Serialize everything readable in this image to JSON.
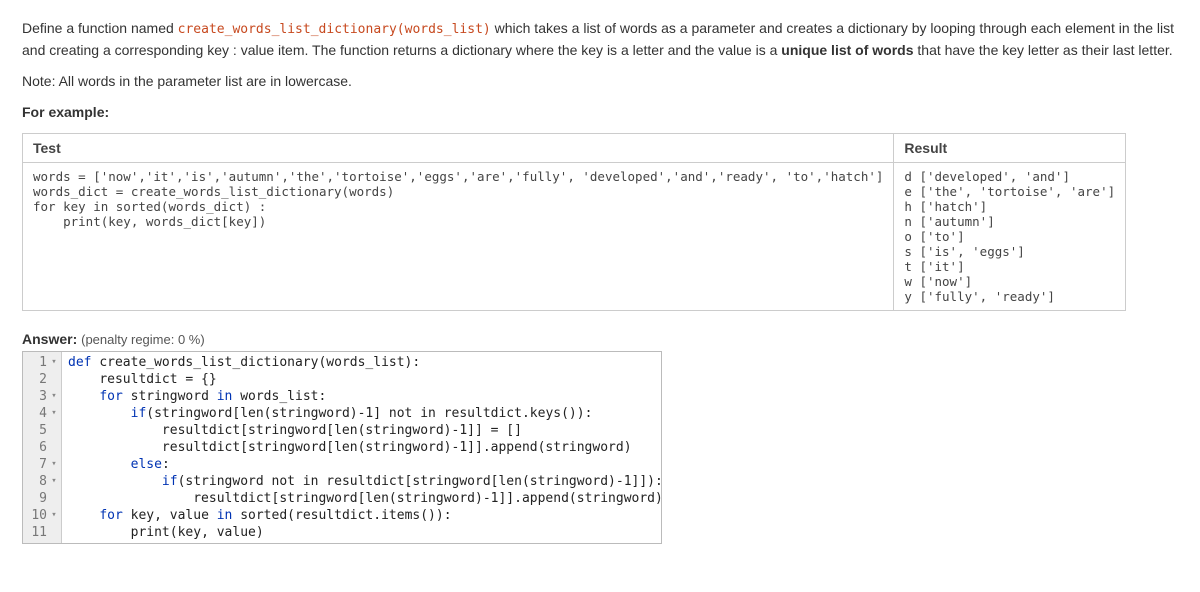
{
  "question": {
    "para1_pre": "Define a function named ",
    "para1_code": "create_words_list_dictionary(words_list)",
    "para1_post": " which takes a list of words as a parameter and creates a dictionary by looping through each element in the list and creating a corresponding key : value item. The function returns a dictionary where the key is a letter and the value is a ",
    "para1_bold": "unique list of words",
    "para1_tail": " that have the key letter as their last letter.",
    "para2": "Note: All words in the parameter list are in lowercase.",
    "para3": "For example:"
  },
  "table": {
    "h1": "Test",
    "h2": "Result",
    "test": "words = ['now','it','is','autumn','the','tortoise','eggs','are','fully', 'developed','and','ready', 'to','hatch']\nwords_dict = create_words_list_dictionary(words)\nfor key in sorted(words_dict) :\n    print(key, words_dict[key])",
    "result": "d ['developed', 'and']\ne ['the', 'tortoise', 'are']\nh ['hatch']\nn ['autumn']\no ['to']\ns ['is', 'eggs']\nt ['it']\nw ['now']\ny ['fully', 'ready']"
  },
  "answer": {
    "label": "Answer:",
    "penalty": "(penalty regime: 0 %)"
  },
  "code": {
    "lines": [
      {
        "n": "1",
        "fold": "▾",
        "kw": "def ",
        "rest": "create_words_list_dictionary(words_list):"
      },
      {
        "n": "2",
        "fold": "",
        "indent": "    ",
        "rest": "resultdict = {}"
      },
      {
        "n": "3",
        "fold": "▾",
        "indent": "    ",
        "kw": "for ",
        "mid": "stringword ",
        "kw2": "in ",
        "rest": "words_list:"
      },
      {
        "n": "4",
        "fold": "▾",
        "indent": "        ",
        "kw": "if",
        "rest": "(stringword[len(stringword)-1] not in resultdict.keys()):"
      },
      {
        "n": "5",
        "fold": "",
        "indent": "            ",
        "rest": "resultdict[stringword[len(stringword)-1]] = []"
      },
      {
        "n": "6",
        "fold": "",
        "indent": "            ",
        "rest": "resultdict[stringword[len(stringword)-1]].append(stringword)"
      },
      {
        "n": "7",
        "fold": "▾",
        "indent": "        ",
        "kw": "else",
        "rest": ":"
      },
      {
        "n": "8",
        "fold": "▾",
        "indent": "            ",
        "kw": "if",
        "rest": "(stringword not in resultdict[stringword[len(stringword)-1]]):"
      },
      {
        "n": "9",
        "fold": "",
        "indent": "                ",
        "rest": "resultdict[stringword[len(stringword)-1]].append(stringword)"
      },
      {
        "n": "10",
        "fold": "▾",
        "indent": "    ",
        "kw": "for ",
        "mid": "key, value ",
        "kw2": "in ",
        "rest": "sorted(resultdict.items()):"
      },
      {
        "n": "11",
        "fold": "",
        "indent": "        ",
        "rest": "print(key, value)"
      }
    ]
  }
}
